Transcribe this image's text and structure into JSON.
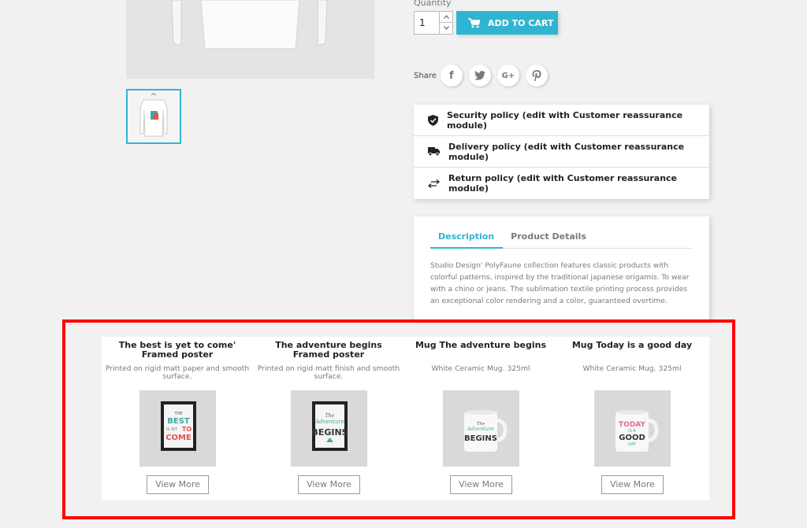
{
  "purchase": {
    "quantity_label": "Quantity",
    "quantity_value": "1",
    "add_to_cart_label": "ADD TO CART"
  },
  "share": {
    "label": "Share",
    "icons": [
      "facebook-icon",
      "twitter-icon",
      "google-plus-icon",
      "pinterest-icon"
    ],
    "facebook_glyph": "f",
    "google_glyph": "G+"
  },
  "reassurance": [
    {
      "icon": "shield-check-icon",
      "label": "Security policy (edit with Customer reassurance module)"
    },
    {
      "icon": "truck-icon",
      "label": "Delivery policy (edit with Customer reassurance module)"
    },
    {
      "icon": "swap-arrows-icon",
      "label": "Return policy (edit with Customer reassurance module)"
    }
  ],
  "tabs": {
    "items": [
      {
        "label": "Description",
        "active": true
      },
      {
        "label": "Product Details",
        "active": false
      }
    ],
    "description": "Studio Design' PolyFaune collection features classic products with colorful patterns, inspired by the traditional japanese origamis. To wear with a chino or jeans. The sublimation textile printing process provides an exceptional color rendering and a color, guaranteed overtime."
  },
  "related_products": [
    {
      "title": "The best is yet to come' Framed poster",
      "description": "Printed on rigid matt paper and smooth surface.",
      "image_text": [
        "THE",
        "BEST",
        "IS YET",
        "TO",
        "COME"
      ],
      "button": "View More"
    },
    {
      "title": "The adventure begins Framed poster",
      "description": "Printed on rigid matt finish and smooth surface.",
      "image_text": [
        "The",
        "Adventure",
        "BEGINS"
      ],
      "button": "View More"
    },
    {
      "title": "Mug The adventure begins",
      "description": "White Ceramic Mug. 325ml",
      "image_text": [
        "The",
        "Adventure",
        "BEGINS"
      ],
      "button": "View More"
    },
    {
      "title": "Mug Today is a good day",
      "description": "White Ceramic Mug. 325ml",
      "image_text": [
        "TODAY",
        "IS A",
        "GOOD",
        "DAY"
      ],
      "button": "View More"
    }
  ],
  "colors": {
    "accent": "#2fb5d2",
    "highlight_border": "#ff0000",
    "background": "#f1f1f1",
    "poster_red": "#e9524e",
    "poster_teal": "#3fa9a1",
    "mug_pink": "#e46a8a"
  }
}
